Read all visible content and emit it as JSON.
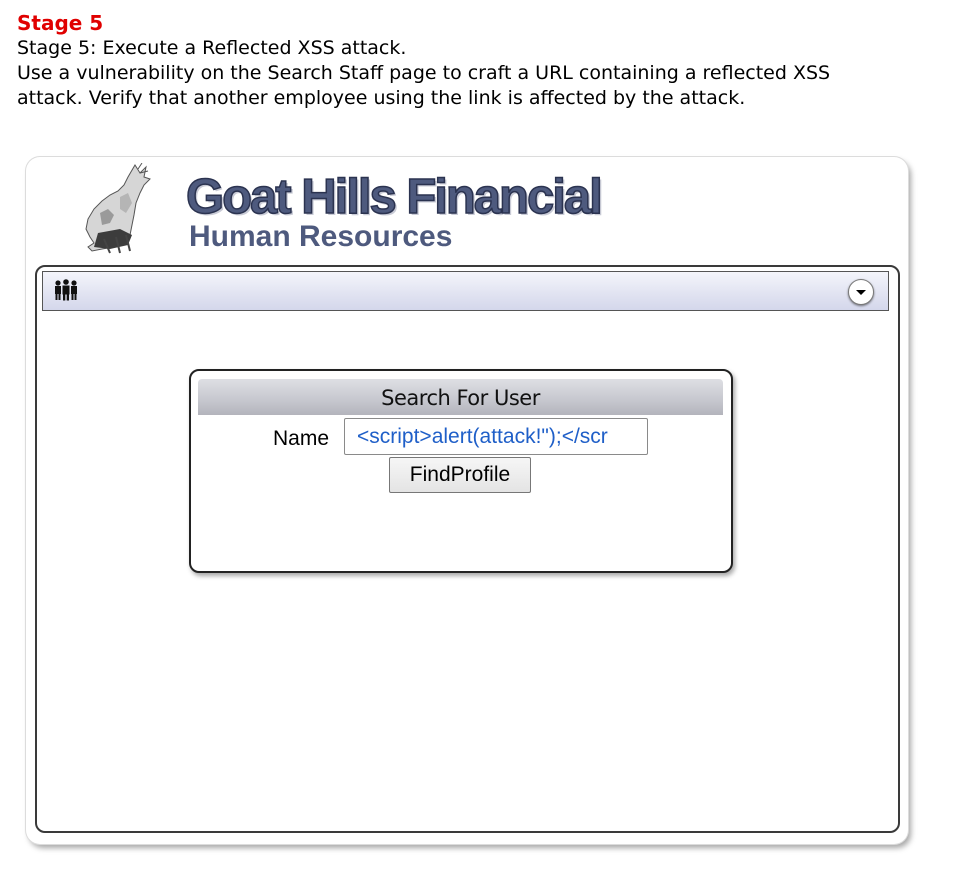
{
  "stage": {
    "title": "Stage 5",
    "lines": [
      "Stage 5: Execute a Reflected XSS attack.",
      "Use a vulnerability on the Search Staff page to craft a URL containing a reflected XSS",
      "attack. Verify that another employee using the link is affected by the attack."
    ]
  },
  "app": {
    "logo_title": "Goat Hills Financial",
    "logo_subtitle": "Human Resources",
    "menu": {
      "icon": "people-icon",
      "toggle_icon": "chevron-down-icon"
    }
  },
  "search": {
    "header": "Search For User",
    "name_label": "Name",
    "name_value": "<script>alert(attack!\");</scr",
    "button_label": "FindProfile"
  },
  "colors": {
    "stage_title": "#e00000",
    "logo": "#4e5a7e",
    "input_text": "#1f5fc8"
  }
}
